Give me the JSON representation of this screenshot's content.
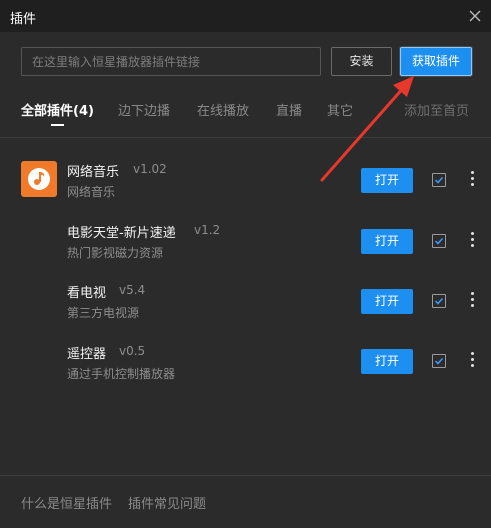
{
  "window": {
    "title": "插件",
    "close_icon": "close-icon"
  },
  "search": {
    "placeholder": "在这里输入恒星播放器插件链接",
    "value": ""
  },
  "buttons": {
    "install_label": "安装",
    "get_plugins_label": "获取插件"
  },
  "tabs": [
    {
      "label": "全部插件(4)",
      "active": true
    },
    {
      "label": "边下边播",
      "active": false
    },
    {
      "label": "在线播放",
      "active": false
    },
    {
      "label": "直播",
      "active": false
    },
    {
      "label": "其它",
      "active": false
    }
  ],
  "add_to_home_label": "添加至首页",
  "plugins": [
    {
      "name": "网络音乐",
      "version": "v1.02",
      "description": "网络音乐",
      "open_label": "打开",
      "checked": true,
      "icon": "music-note-icon"
    },
    {
      "name": "电影天堂-新片速递",
      "version": "v1.2",
      "description": "热门影视磁力资源",
      "open_label": "打开",
      "checked": true
    },
    {
      "name": "看电视",
      "version": "v5.4",
      "description": "第三方电视源",
      "open_label": "打开",
      "checked": true
    },
    {
      "name": "遥控器",
      "version": "v0.5",
      "description": "通过手机控制播放器",
      "open_label": "打开",
      "checked": true
    }
  ],
  "footer": {
    "what_is_label": "什么是恒星插件",
    "faq_label": "插件常见问题"
  },
  "colors": {
    "accent": "#1d8ff0",
    "background": "#2b2b2b",
    "titlebar": "#1f1f1f",
    "annotation_arrow": "#e8372b",
    "music_icon_bg": "#f07a2a"
  }
}
